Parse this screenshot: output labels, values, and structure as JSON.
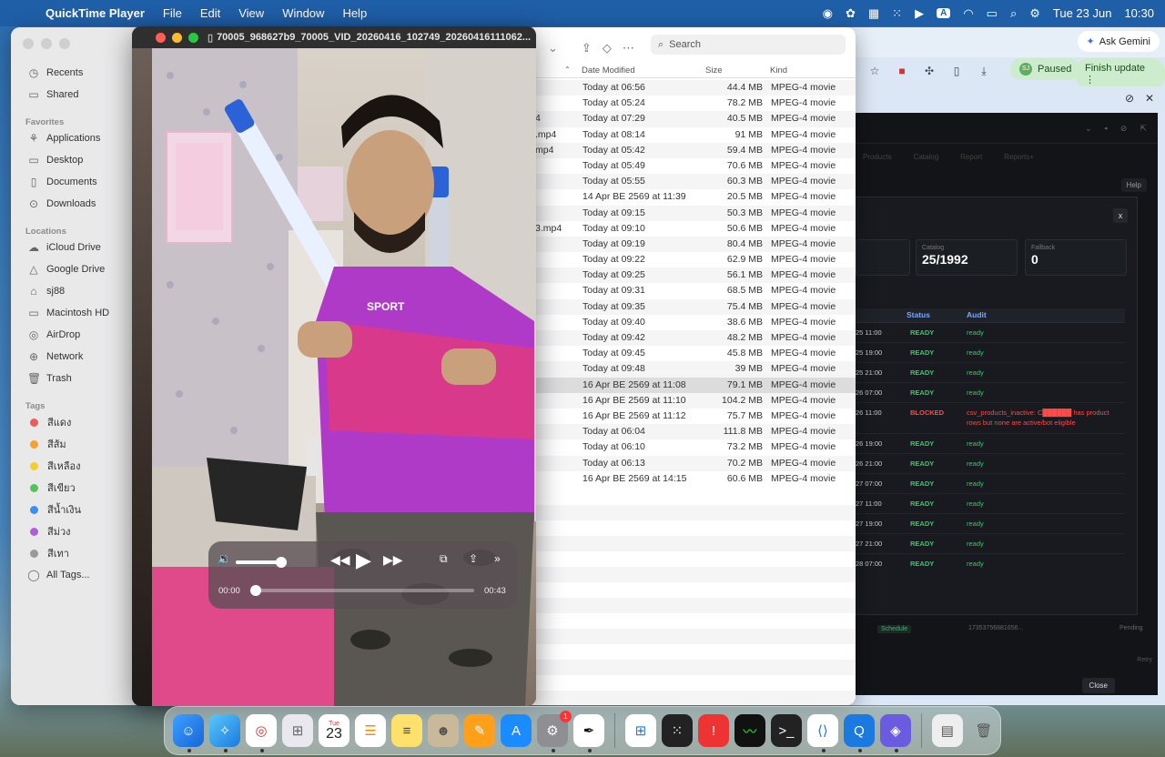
{
  "menubar": {
    "app_name": "QuickTime Player",
    "menus": [
      "File",
      "Edit",
      "View",
      "Window",
      "Help"
    ],
    "date": "Tue 23 Jun",
    "time": "10:30",
    "input_source": "A"
  },
  "browser": {
    "ask_gemini": "Ask Gemini",
    "paused": "Paused",
    "profile_initials": "SJ",
    "finish_update": "Finish update",
    "dark_app": {
      "nav": [
        "Products",
        "Catalog",
        "Report",
        "Reports+"
      ],
      "help": "Help",
      "modal": {
        "close_x": "x",
        "stats": [
          {
            "label": "Catalog",
            "value": "25/1992"
          },
          {
            "label": "Fallback",
            "value": "0"
          }
        ],
        "columns": [
          "Status",
          "Audit"
        ],
        "rows": [
          {
            "date": "25 11:00",
            "status": "READY",
            "audit": "ready",
            "kind": "ready"
          },
          {
            "date": "25 19:00",
            "status": "READY",
            "audit": "ready",
            "kind": "ready"
          },
          {
            "date": "25 21:00",
            "status": "READY",
            "audit": "ready",
            "kind": "ready"
          },
          {
            "date": "26 07:00",
            "status": "READY",
            "audit": "ready",
            "kind": "ready"
          },
          {
            "date": "26 11:00",
            "status": "BLOCKED",
            "audit": "csv_products_inactive: C██████ has product rows but none are active/bot eligible",
            "kind": "blocked"
          },
          {
            "date": "26 19:00",
            "status": "READY",
            "audit": "ready",
            "kind": "ready"
          },
          {
            "date": "26 21:00",
            "status": "READY",
            "audit": "ready",
            "kind": "ready"
          },
          {
            "date": "27 07:00",
            "status": "READY",
            "audit": "ready",
            "kind": "ready"
          },
          {
            "date": "27 11:00",
            "status": "READY",
            "audit": "ready",
            "kind": "ready"
          },
          {
            "date": "27 19:00",
            "status": "READY",
            "audit": "ready",
            "kind": "ready"
          },
          {
            "date": "27 21:00",
            "status": "READY",
            "audit": "ready",
            "kind": "ready"
          },
          {
            "date": "28 07:00",
            "status": "READY",
            "audit": "ready",
            "kind": "ready"
          },
          {
            "date": "28 11:00",
            "status": "READY",
            "audit": "ready",
            "kind": "ready"
          }
        ],
        "close": "Close"
      },
      "schedule_row": {
        "tag": "Schedule",
        "id": "17353756881656...",
        "state": "Pending"
      },
      "retry": "Retry"
    }
  },
  "finder": {
    "sidebar": {
      "recents": "Recents",
      "shared": "Shared",
      "favorites_title": "Favorites",
      "favorites": [
        "Applications",
        "Desktop",
        "Documents",
        "Downloads"
      ],
      "locations_title": "Locations",
      "locations": [
        "iCloud Drive",
        "Google Drive",
        "sj88",
        "Macintosh HD",
        "AirDrop",
        "Network",
        "Trash"
      ],
      "tags_title": "Tags",
      "tags": [
        {
          "name": "สีแดง",
          "color": "#ef5b5b"
        },
        {
          "name": "สีส้ม",
          "color": "#f5a030"
        },
        {
          "name": "สีเหลือง",
          "color": "#f2cf2c"
        },
        {
          "name": "สีเขียว",
          "color": "#52c45a"
        },
        {
          "name": "สีน้ำเงิน",
          "color": "#3d8ef0"
        },
        {
          "name": "สีม่วง",
          "color": "#b25fd6"
        },
        {
          "name": "สีเทา",
          "color": "#9a9a9a"
        }
      ],
      "all_tags": "All Tags..."
    },
    "search_placeholder": "Search",
    "columns": {
      "date": "Date Modified",
      "size": "Size",
      "kind": "Kind"
    },
    "files": [
      {
        "name": "",
        "date": "Today at 06:56",
        "size": "44.4 MB",
        "kind": "MPEG-4 movie"
      },
      {
        "name": "",
        "date": "Today at 05:24",
        "size": "78.2 MB",
        "kind": "MPEG-4 movie"
      },
      {
        "name": "4",
        "date": "Today at 07:29",
        "size": "40.5 MB",
        "kind": "MPEG-4 movie"
      },
      {
        "name": ".mp4",
        "date": "Today at 08:14",
        "size": "91 MB",
        "kind": "MPEG-4 movie"
      },
      {
        "name": "mp4",
        "date": "Today at 05:42",
        "size": "59.4 MB",
        "kind": "MPEG-4 movie"
      },
      {
        "name": "",
        "date": "Today at 05:49",
        "size": "70.6 MB",
        "kind": "MPEG-4 movie"
      },
      {
        "name": "",
        "date": "Today at 05:55",
        "size": "60.3 MB",
        "kind": "MPEG-4 movie"
      },
      {
        "name": "",
        "date": "14 Apr BE 2569 at 11:39",
        "size": "20.5 MB",
        "kind": "MPEG-4 movie"
      },
      {
        "name": "",
        "date": "Today at 09:15",
        "size": "50.3 MB",
        "kind": "MPEG-4 movie"
      },
      {
        "name": "3.mp4",
        "date": "Today at 09:10",
        "size": "50.6 MB",
        "kind": "MPEG-4 movie"
      },
      {
        "name": "",
        "date": "Today at 09:19",
        "size": "80.4 MB",
        "kind": "MPEG-4 movie"
      },
      {
        "name": "",
        "date": "Today at 09:22",
        "size": "62.9 MB",
        "kind": "MPEG-4 movie"
      },
      {
        "name": "",
        "date": "Today at 09:25",
        "size": "56.1 MB",
        "kind": "MPEG-4 movie"
      },
      {
        "name": "",
        "date": "Today at 09:31",
        "size": "68.5 MB",
        "kind": "MPEG-4 movie"
      },
      {
        "name": "",
        "date": "Today at 09:35",
        "size": "75.4 MB",
        "kind": "MPEG-4 movie"
      },
      {
        "name": "",
        "date": "Today at 09:40",
        "size": "38.6 MB",
        "kind": "MPEG-4 movie"
      },
      {
        "name": "",
        "date": "Today at 09:42",
        "size": "48.2 MB",
        "kind": "MPEG-4 movie"
      },
      {
        "name": "",
        "date": "Today at 09:45",
        "size": "45.8 MB",
        "kind": "MPEG-4 movie"
      },
      {
        "name": "",
        "date": "Today at 09:48",
        "size": "39 MB",
        "kind": "MPEG-4 movie"
      },
      {
        "name": "",
        "date": "16 Apr BE 2569 at 11:08",
        "size": "79.1 MB",
        "kind": "MPEG-4 movie",
        "selected": true
      },
      {
        "name": "",
        "date": "16 Apr BE 2569 at 11:10",
        "size": "104.2 MB",
        "kind": "MPEG-4 movie"
      },
      {
        "name": "",
        "date": "16 Apr BE 2569 at 11:12",
        "size": "75.7 MB",
        "kind": "MPEG-4 movie"
      },
      {
        "name": "",
        "date": "Today at 06:04",
        "size": "111.8 MB",
        "kind": "MPEG-4 movie"
      },
      {
        "name": "",
        "date": "Today at 06:10",
        "size": "73.2 MB",
        "kind": "MPEG-4 movie"
      },
      {
        "name": "",
        "date": "Today at 06:13",
        "size": "70.2 MB",
        "kind": "MPEG-4 movie"
      },
      {
        "name": "",
        "date": "16 Apr BE 2569 at 14:15",
        "size": "60.6 MB",
        "kind": "MPEG-4 movie"
      }
    ]
  },
  "quicktime": {
    "title": "70005_968627b9_70005_VID_20260416_102749_20260416111062...",
    "shirt_text": "SPORT",
    "current_time": "00:00",
    "duration": "00:43",
    "volume_fraction": 0.9,
    "progress_fraction": 0.0
  },
  "dock": {
    "calendar_month": "Tue",
    "calendar_day": "23",
    "settings_badge": "1",
    "apps": [
      "finder-icon",
      "safari-icon",
      "chrome-icon",
      "launchpad-icon",
      "calendar-icon",
      "reminders-icon",
      "notes-icon",
      "contacts-icon",
      "pages-icon",
      "app-store-icon",
      "system-settings-icon",
      "script-icon",
      "windows-app-icon",
      "dots-app-icon",
      "mimo-icon",
      "activity-monitor-icon",
      "terminal-icon",
      "vscode-icon",
      "quicktime-icon",
      "remote-icon"
    ]
  }
}
